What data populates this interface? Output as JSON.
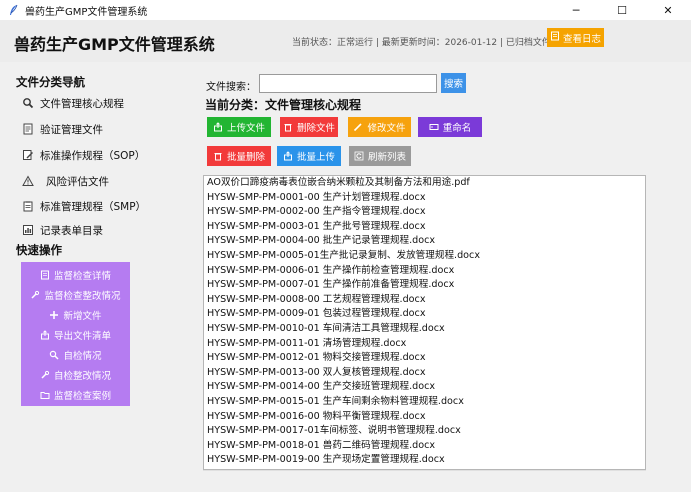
{
  "window": {
    "title": "兽药生产GMP文件管理系统",
    "minimize": "─",
    "maximize": "☐",
    "close": "✕"
  },
  "header": {
    "title": "兽药生产GMP文件管理系统",
    "status": "当前状态：正常运行 | 最新更新时间：2026-01-12 | 已归档文件：",
    "log_button": "查看日志"
  },
  "sidebar": {
    "nav_title": "文件分类导航",
    "nav_items": [
      {
        "label": "文件管理核心规程",
        "icon": "magnifier-icon"
      },
      {
        "label": "验证管理文件",
        "icon": "document-icon"
      },
      {
        "label": "标准操作规程（SOP）",
        "icon": "edit-document-icon"
      },
      {
        "label": "风险评估文件",
        "icon": "warning-icon"
      },
      {
        "label": "标准管理规程（SMP）",
        "icon": "clipboard-icon"
      },
      {
        "label": "记录表单目录",
        "icon": "chart-icon"
      }
    ],
    "quick_title": "快速操作",
    "quick_items": [
      {
        "label": "监督检查详情",
        "icon": "document-icon"
      },
      {
        "label": "监督检查整改情况",
        "icon": "wrench-icon"
      },
      {
        "label": "新增文件",
        "icon": "plus-icon"
      },
      {
        "label": "导出文件清单",
        "icon": "export-icon"
      },
      {
        "label": "自检情况",
        "icon": "magnifier-icon"
      },
      {
        "label": "自检整改情况",
        "icon": "wrench-icon"
      },
      {
        "label": "监督检查案例",
        "icon": "folder-icon"
      }
    ]
  },
  "main": {
    "search_label": "文件搜索：",
    "search_value": "",
    "search_button": "搜索",
    "category_title": "当前分类：文件管理核心规程",
    "buttons": {
      "upload": "上传文件",
      "delete": "删除文件",
      "modify": "修改文件",
      "rename": "重命名",
      "batch_delete": "批量删除",
      "batch_upload": "批量上传",
      "refresh": "刷新列表"
    },
    "files": [
      "AO双价口蹄疫病毒表位嵌合纳米颗粒及其制备方法和用途.pdf",
      "HYSW-SMP-PM-0001-00 生产计划管理规程.docx",
      "HYSW-SMP-PM-0002-00 生产指令管理规程.docx",
      "HYSW-SMP-PM-0003-01 生产批号管理规程.docx",
      "HYSW-SMP-PM-0004-00 批生产记录管理规程.docx",
      "HYSW-SMP-PM-0005-01生产批记录复制、发放管理规程.docx",
      "HYSW-SMP-PM-0006-01 生产操作前检查管理规程.docx",
      "HYSW-SMP-PM-0007-01 生产操作前准备管理规程.docx",
      "HYSW-SMP-PM-0008-00 工艺规程管理规程.docx",
      "HYSW-SMP-PM-0009-01 包装过程管理规程.docx",
      "HYSW-SMP-PM-0010-01 车间清洁工具管理规程.docx",
      "HYSW-SMP-PM-0011-01 清场管理规程.docx",
      "HYSW-SMP-PM-0012-01 物料交接管理规程.docx",
      "HYSW-SMP-PM-0013-00 双人复核管理规程.docx",
      "HYSW-SMP-PM-0014-00 生产交接班管理规程.docx",
      "HYSW-SMP-PM-0015-01 生产车间剩余物料管理规程.docx",
      "HYSW-SMP-PM-0016-00 物料平衡管理规程.docx",
      "HYSW-SMP-PM-0017-01车间标签、说明书管理规程.docx",
      "HYSW-SMP-PM-0018-01 兽药二维码管理规程.docx",
      "HYSW-SMP-PM-0019-00 生产现场定置管理规程.docx"
    ]
  }
}
